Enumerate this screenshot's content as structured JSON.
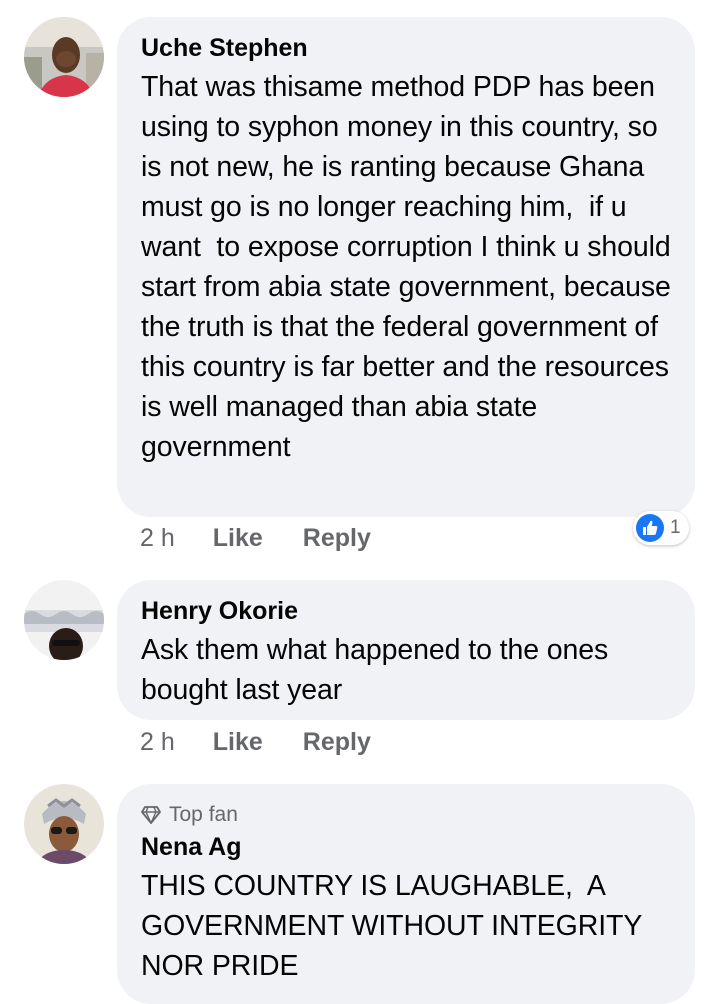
{
  "comments": [
    {
      "author": "Uche Stephen",
      "text": "That was thisame method PDP has been using to syphon money in this country, so is not new, he is ranting because Ghana must go is no longer reaching him,  if u want  to expose corruption I think u should start from abia state government, because the truth is that the federal government of this country is far better and the resources is well managed than abia state government",
      "time": "2 h",
      "like": "Like",
      "reply": "Reply",
      "reaction_count": "1"
    },
    {
      "author": "Henry Okorie",
      "text": "Ask them what happened to the ones bought last year",
      "time": "2 h",
      "like": "Like",
      "reply": "Reply"
    },
    {
      "badge": "Top fan",
      "author": "Nena Ag",
      "text": "THIS COUNTRY IS LAUGHABLE,  A GOVERNMENT WITHOUT INTEGRITY NOR PRIDE"
    }
  ],
  "colors": {
    "bubble": "#f0f2f5",
    "secondary_text": "#65676b",
    "like_blue": "#1877f2"
  },
  "icons": [
    "like-reaction-icon",
    "diamond-icon"
  ]
}
